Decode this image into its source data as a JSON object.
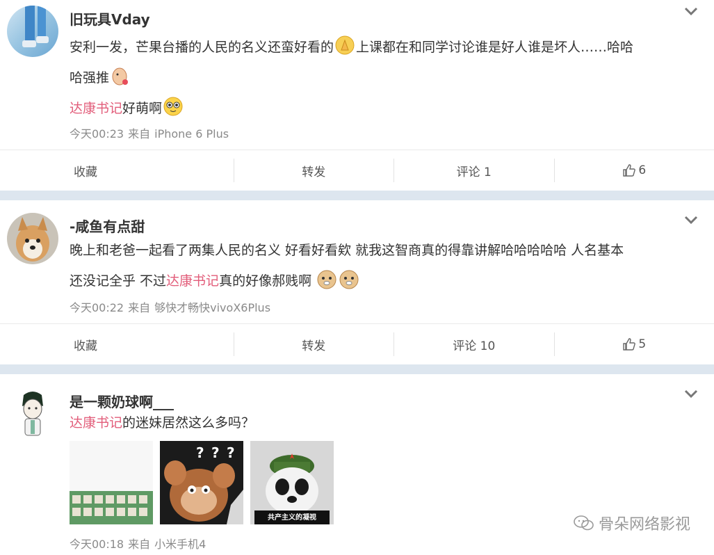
{
  "posts": [
    {
      "username": "旧玩具Vday",
      "text1": "安利一发，芒果台播的人民的名义还蛮好看的",
      "text2": "上课都在和同学讨论谁是好人谁是坏人……哈哈",
      "text3": "哈强推",
      "mention": "达康书记",
      "text4": "好萌啊",
      "time": "今天00:23",
      "from": "来自",
      "source": "iPhone 6 Plus",
      "actions": {
        "collect": "收藏",
        "repost": "转发",
        "comment": "评论 1",
        "like": "6"
      }
    },
    {
      "username": "-咸鱼有点甜",
      "text1": "晚上和老爸一起看了两集人民的名义 好看好看欸 就我这智商真的得靠讲解哈哈哈哈哈 人名基本",
      "text2": "还没记全乎 不过",
      "mention": "达康书记",
      "text3": "真的好像郝贱啊",
      "time": "今天00:22",
      "from": "来自",
      "source": "够快才畅快vivoX6Plus",
      "actions": {
        "collect": "收藏",
        "repost": "转发",
        "comment": "评论 10",
        "like": "5"
      }
    },
    {
      "username": "是一颗奶球啊___",
      "mention": "达康书记",
      "text1": "的迷妹居然这么多吗？",
      "image_caption": "共产主义的凝视",
      "time": "今天00:18",
      "from": "来自",
      "source": "小米手机4"
    }
  ],
  "watermark": "骨朵网络影视",
  "colors": {
    "mention": "#e25d7a",
    "separator": "#dde6ef",
    "meta": "#8a8a8a"
  },
  "icons": {
    "expand": "chevron-down-icon",
    "like": "thumbs-up-icon"
  }
}
